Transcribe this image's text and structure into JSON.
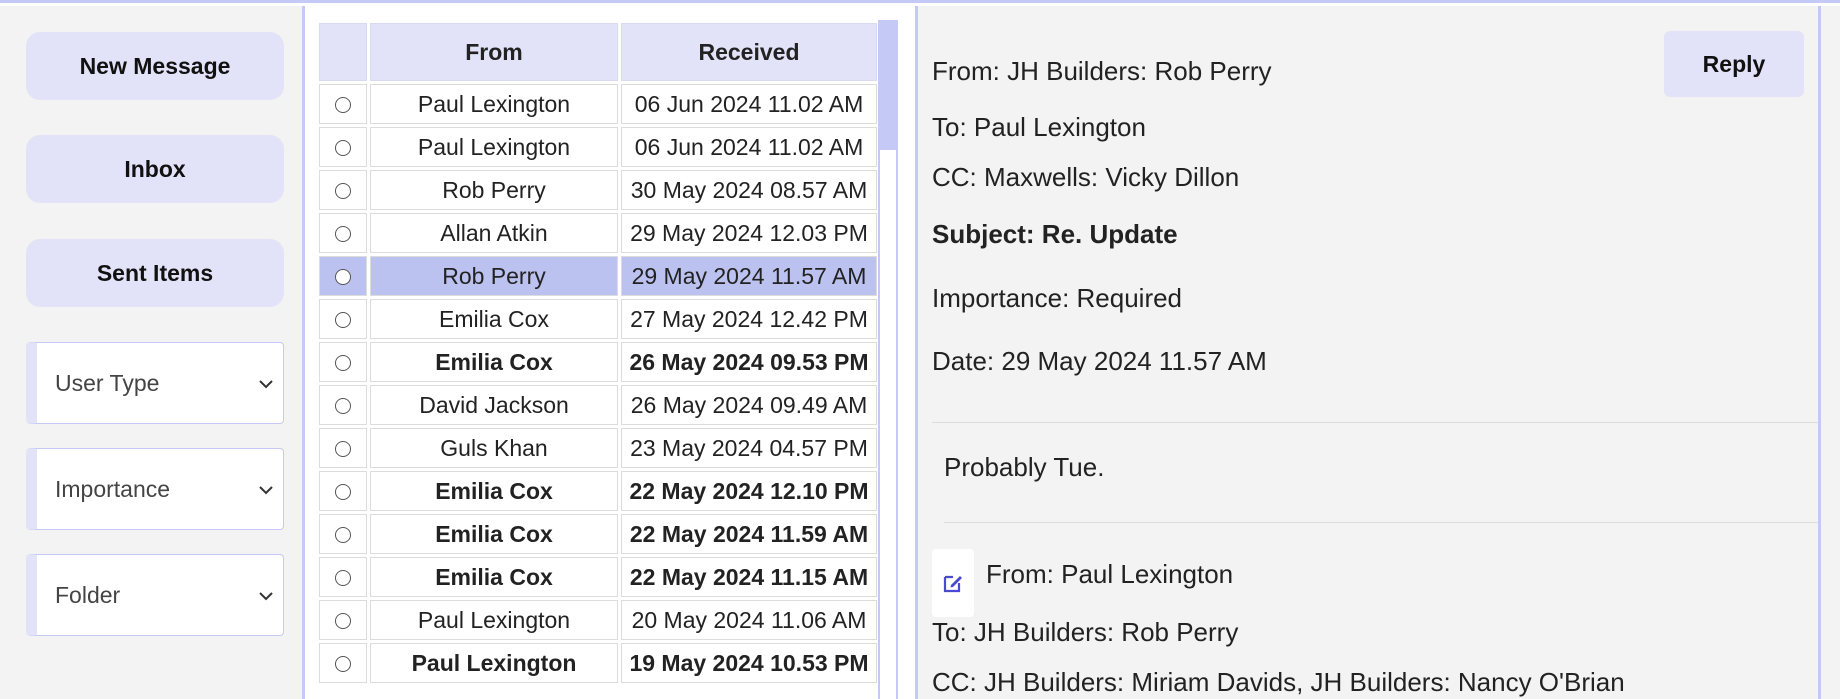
{
  "sidebar": {
    "new_message": "New Message",
    "inbox": "Inbox",
    "sent_items": "Sent Items",
    "user_type": "User Type",
    "importance": "Importance",
    "folder": "Folder"
  },
  "list": {
    "col_from": "From",
    "col_received": "Received",
    "rows": [
      {
        "from": "Paul Lexington",
        "received": "06 Jun 2024 11.02 AM",
        "unread": false,
        "selected": false
      },
      {
        "from": "Paul Lexington",
        "received": "06 Jun 2024 11.02 AM",
        "unread": false,
        "selected": false
      },
      {
        "from": "Rob Perry",
        "received": "30 May 2024 08.57 AM",
        "unread": false,
        "selected": false
      },
      {
        "from": "Allan Atkin",
        "received": "29 May 2024 12.03 PM",
        "unread": false,
        "selected": false
      },
      {
        "from": "Rob Perry",
        "received": "29 May 2024 11.57 AM",
        "unread": false,
        "selected": true
      },
      {
        "from": "Emilia Cox",
        "received": "27 May 2024 12.42 PM",
        "unread": false,
        "selected": false
      },
      {
        "from": "Emilia Cox",
        "received": "26 May 2024 09.53 PM",
        "unread": true,
        "selected": false
      },
      {
        "from": "David Jackson",
        "received": "26 May 2024 09.49 AM",
        "unread": false,
        "selected": false
      },
      {
        "from": "Guls Khan",
        "received": "23 May 2024 04.57 PM",
        "unread": false,
        "selected": false
      },
      {
        "from": "Emilia Cox",
        "received": "22 May 2024 12.10 PM",
        "unread": true,
        "selected": false
      },
      {
        "from": "Emilia Cox",
        "received": "22 May 2024 11.59 AM",
        "unread": true,
        "selected": false
      },
      {
        "from": "Emilia Cox",
        "received": "22 May 2024 11.15 AM",
        "unread": true,
        "selected": false
      },
      {
        "from": "Paul Lexington",
        "received": "20 May 2024 11.06 AM",
        "unread": false,
        "selected": false
      },
      {
        "from": "Paul Lexington",
        "received": "19 May 2024 10.53 PM",
        "unread": true,
        "selected": false
      }
    ]
  },
  "reading": {
    "reply": "Reply",
    "from": "From: JH Builders: Rob Perry",
    "to": "To: Paul Lexington",
    "cc": "CC: Maxwells: Vicky Dillon",
    "subject": "Subject: Re. Update",
    "importance": "Importance: Required",
    "date": "Date: 29 May 2024 11.57 AM",
    "body": "Probably Tue.",
    "quoted_from": "From: Paul Lexington",
    "quoted_to": "To: JH Builders: Rob Perry",
    "quoted_cc": "CC: JH Builders: Miriam Davids, JH Builders: Nancy O'Brian"
  },
  "colors": {
    "accent": "#c5c9f5",
    "button_bg": "#e2e3f8",
    "selected_row": "#bcc2f0",
    "edit_icon": "#4a4ad0"
  }
}
